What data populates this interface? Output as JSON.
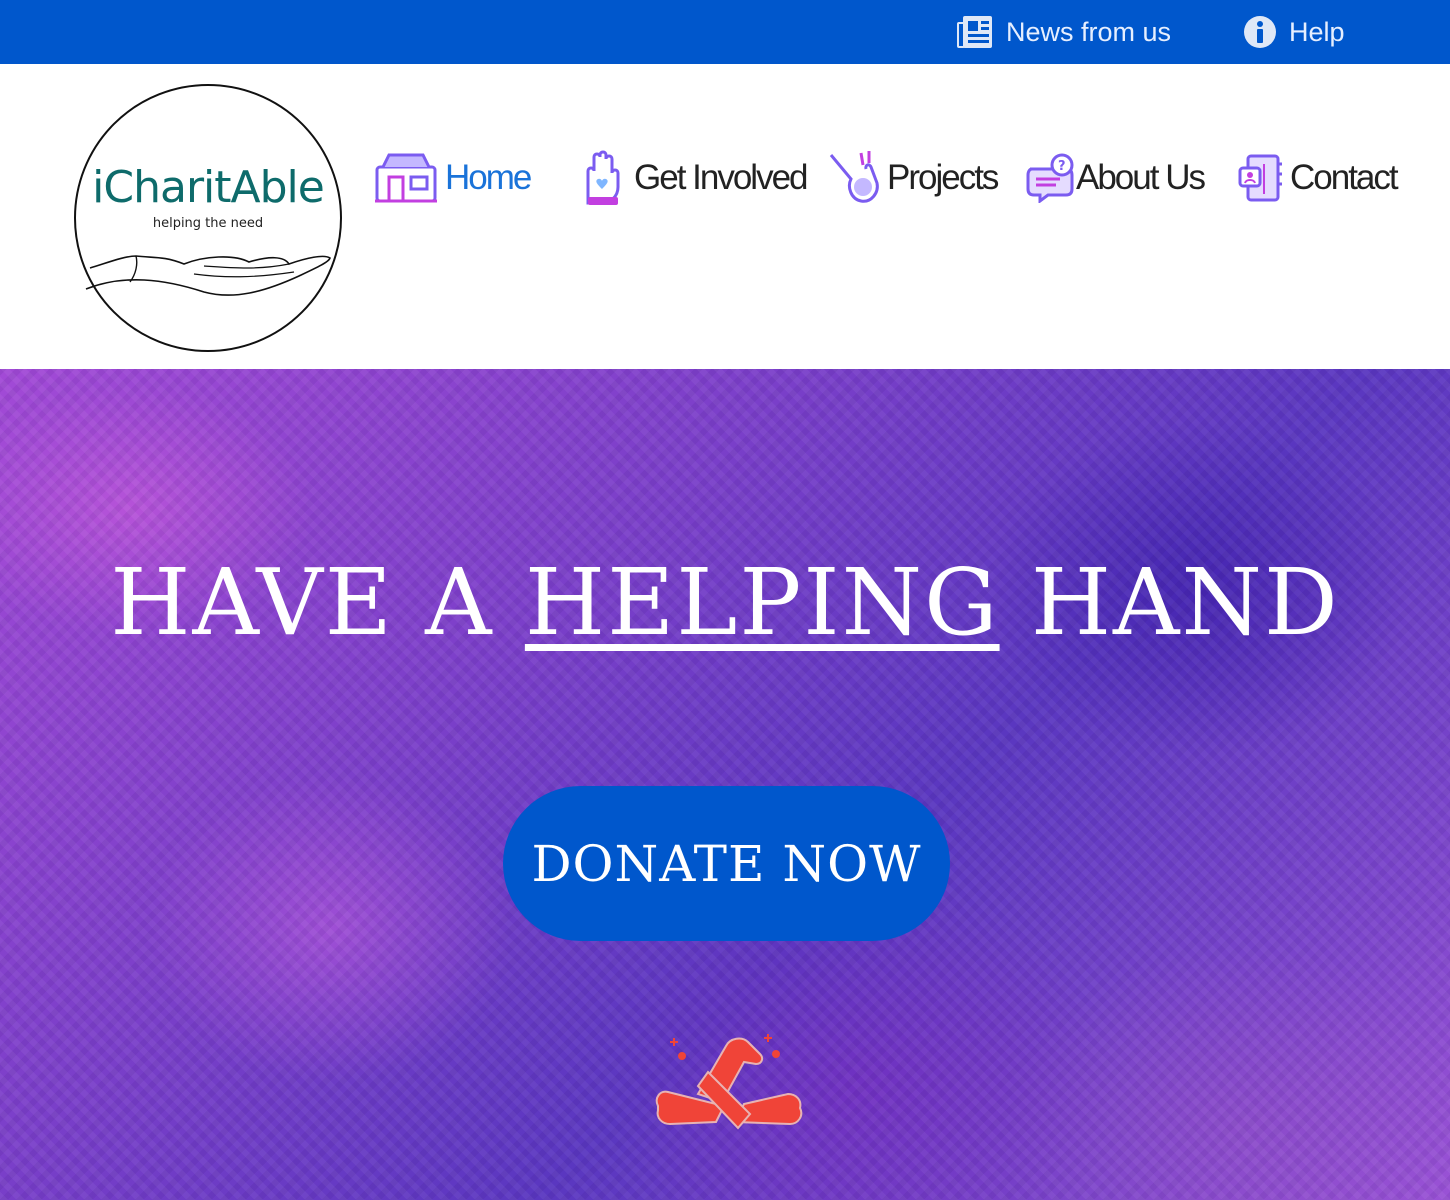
{
  "topbar": {
    "news_label": "News from us",
    "help_label": "Help",
    "news_icon": "newspaper-icon",
    "help_icon": "info-icon",
    "bg_color": "#0057cc"
  },
  "logo": {
    "brand": "iCharitAble",
    "tagline": "helping the need",
    "brand_color": "#0e6b6b"
  },
  "nav": {
    "items": [
      {
        "label": "Home",
        "icon": "house-icon",
        "active": true
      },
      {
        "label": "Get Involved",
        "icon": "raised-hand-icon",
        "active": false
      },
      {
        "label": "Projects",
        "icon": "hand-drop-icon",
        "active": false
      },
      {
        "label": "About Us",
        "icon": "chat-question-icon",
        "active": false
      },
      {
        "label": "Contact",
        "icon": "address-book-icon",
        "active": false
      }
    ],
    "active_color": "#1a73d9"
  },
  "hero": {
    "title_before": "HAVE A ",
    "title_emphasis": "HELPING",
    "title_after": " HAND",
    "donate_label": "DONATE NOW",
    "donate_color": "#0057cc",
    "hands_icon": "united-hands-icon",
    "hands_color": "#f04438"
  }
}
